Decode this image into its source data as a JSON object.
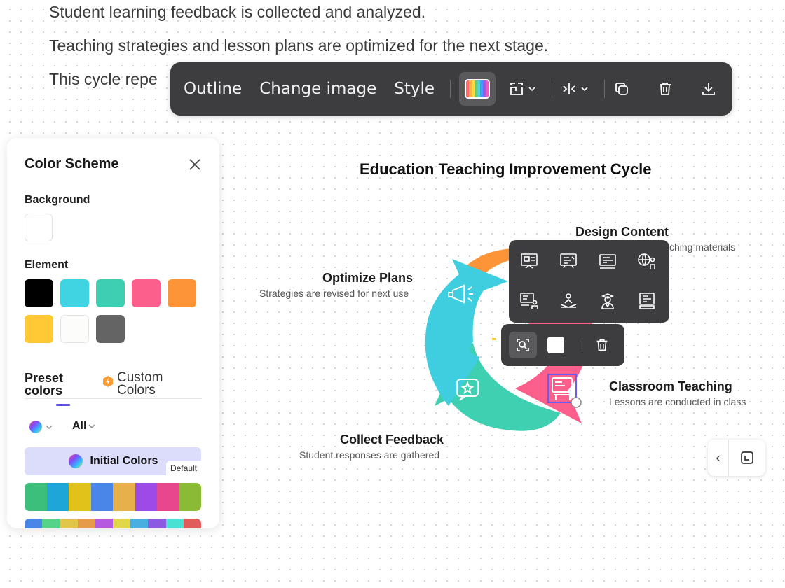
{
  "document": {
    "lines": [
      "Student learning feedback is collected and analyzed.",
      "Teaching strategies and lesson plans are optimized for the next stage.",
      "This cycle repe"
    ]
  },
  "toolbar": {
    "outline": "Outline",
    "change_image": "Change image",
    "style": "Style",
    "palette_colors": [
      "#ff6b6b",
      "#ffb347",
      "#ffd93d",
      "#6bcb77",
      "#4dd0e1",
      "#4d96ff",
      "#9b5de5",
      "#f15bb5"
    ],
    "icons": [
      "color-palette-icon",
      "layout-icon",
      "spacing-icon",
      "duplicate-icon",
      "trash-icon",
      "download-icon"
    ]
  },
  "color_panel": {
    "title": "Color Scheme",
    "background_label": "Background",
    "element_label": "Element",
    "background_color": "#ffffff",
    "element_colors": [
      "#000000",
      "#40d4e3",
      "#3ecfb2",
      "#fc5f8b",
      "#fe9438",
      "#ffc935",
      "#fcfcfa",
      "#646464"
    ],
    "tabs": {
      "preset": "Preset colors",
      "custom": "Custom Colors"
    },
    "filter_all": "All",
    "initial_colors": "Initial Colors",
    "default_badge": "Default",
    "strip1": [
      "#3cbf7a",
      "#1fa6d9",
      "#e0c21a",
      "#4a86e8",
      "#e8b04a",
      "#9c4be8",
      "#e8478e",
      "#8bbb34"
    ],
    "strip2": [
      "#4a86e8",
      "#55d38b",
      "#e0c64a",
      "#e59b4a",
      "#b45be0",
      "#e0d84a",
      "#4aaee0",
      "#8a5be0",
      "#4ae0d2",
      "#e05b5b"
    ]
  },
  "chart": {
    "title": "Education Teaching Improvement Cycle",
    "steps": [
      {
        "title": "Design Content",
        "desc": "ching materials"
      },
      {
        "title": "Optimize Plans",
        "desc": "Strategies are revised for next use"
      },
      {
        "title": "Classroom Teaching",
        "desc": "Lessons are conducted in class"
      },
      {
        "title": "Collect Feedback",
        "desc": "Student responses are gathered"
      }
    ],
    "colors": {
      "cyan": "#3fcedf",
      "teal": "#3fcfb1",
      "pink": "#fc5f8b",
      "orange": "#fe9438"
    }
  },
  "icon_picker": {
    "icons": [
      "presentation-board-icon",
      "chalkboard-icon",
      "monitor-lesson-icon",
      "globe-teacher-icon",
      "online-class-icon",
      "reading-student-icon",
      "graduate-icon",
      "certificate-icon"
    ]
  },
  "nav": {
    "prev": "‹"
  }
}
